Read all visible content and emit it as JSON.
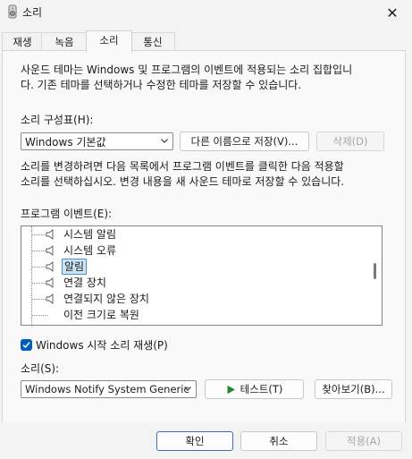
{
  "window": {
    "title": "소리",
    "close_glyph": "✕"
  },
  "tabs": [
    {
      "label": "재생",
      "active": false
    },
    {
      "label": "녹음",
      "active": false
    },
    {
      "label": "소리",
      "active": true
    },
    {
      "label": "통신",
      "active": false
    }
  ],
  "scheme": {
    "description_line1": "사운드 테마는 Windows 및 프로그램의 이벤트에 적용되는 소리 집합입니",
    "description_line2": "다. 기존 테마를 선택하거나 수정한 테마를 저장할 수 있습니다.",
    "label": "소리 구성표(H):",
    "selected": "Windows 기본값",
    "save_as_label": "다른 이름으로 저장(V)...",
    "delete_label": "삭제(D)"
  },
  "events": {
    "instructions_line1": "소리를 변경하려면 다음 목록에서 프로그램 이벤트를 클릭한 다음 적용할",
    "instructions_line2": "소리를 선택하십시오. 변경 내용을 새 사운드 테마로 저장할 수 있습니다.",
    "label": "프로그램 이벤트(E):",
    "items": [
      {
        "label": "시스템 알림",
        "has_sound": true,
        "selected": false
      },
      {
        "label": "시스템 오류",
        "has_sound": true,
        "selected": false
      },
      {
        "label": "알림",
        "has_sound": true,
        "selected": true
      },
      {
        "label": "연결 장치",
        "has_sound": true,
        "selected": false
      },
      {
        "label": "연결되지 않은 장치",
        "has_sound": true,
        "selected": false
      },
      {
        "label": "이전 크기로 복원",
        "has_sound": false,
        "selected": false
      }
    ]
  },
  "startup": {
    "label": "Windows 시작 소리 재생(P)",
    "checked": true
  },
  "sound": {
    "label": "소리(S):",
    "selected": "Windows Notify System Generic",
    "test_label": "테스트(T)",
    "browse_label": "찾아보기(B)..."
  },
  "footer": {
    "ok_label": "확인",
    "cancel_label": "취소",
    "apply_label": "적용(A)"
  },
  "colors": {
    "accent": "#005fb8",
    "selection": "#cce4f7",
    "selection_border": "#4a90d9",
    "play_icon": "#1f8a2e"
  }
}
